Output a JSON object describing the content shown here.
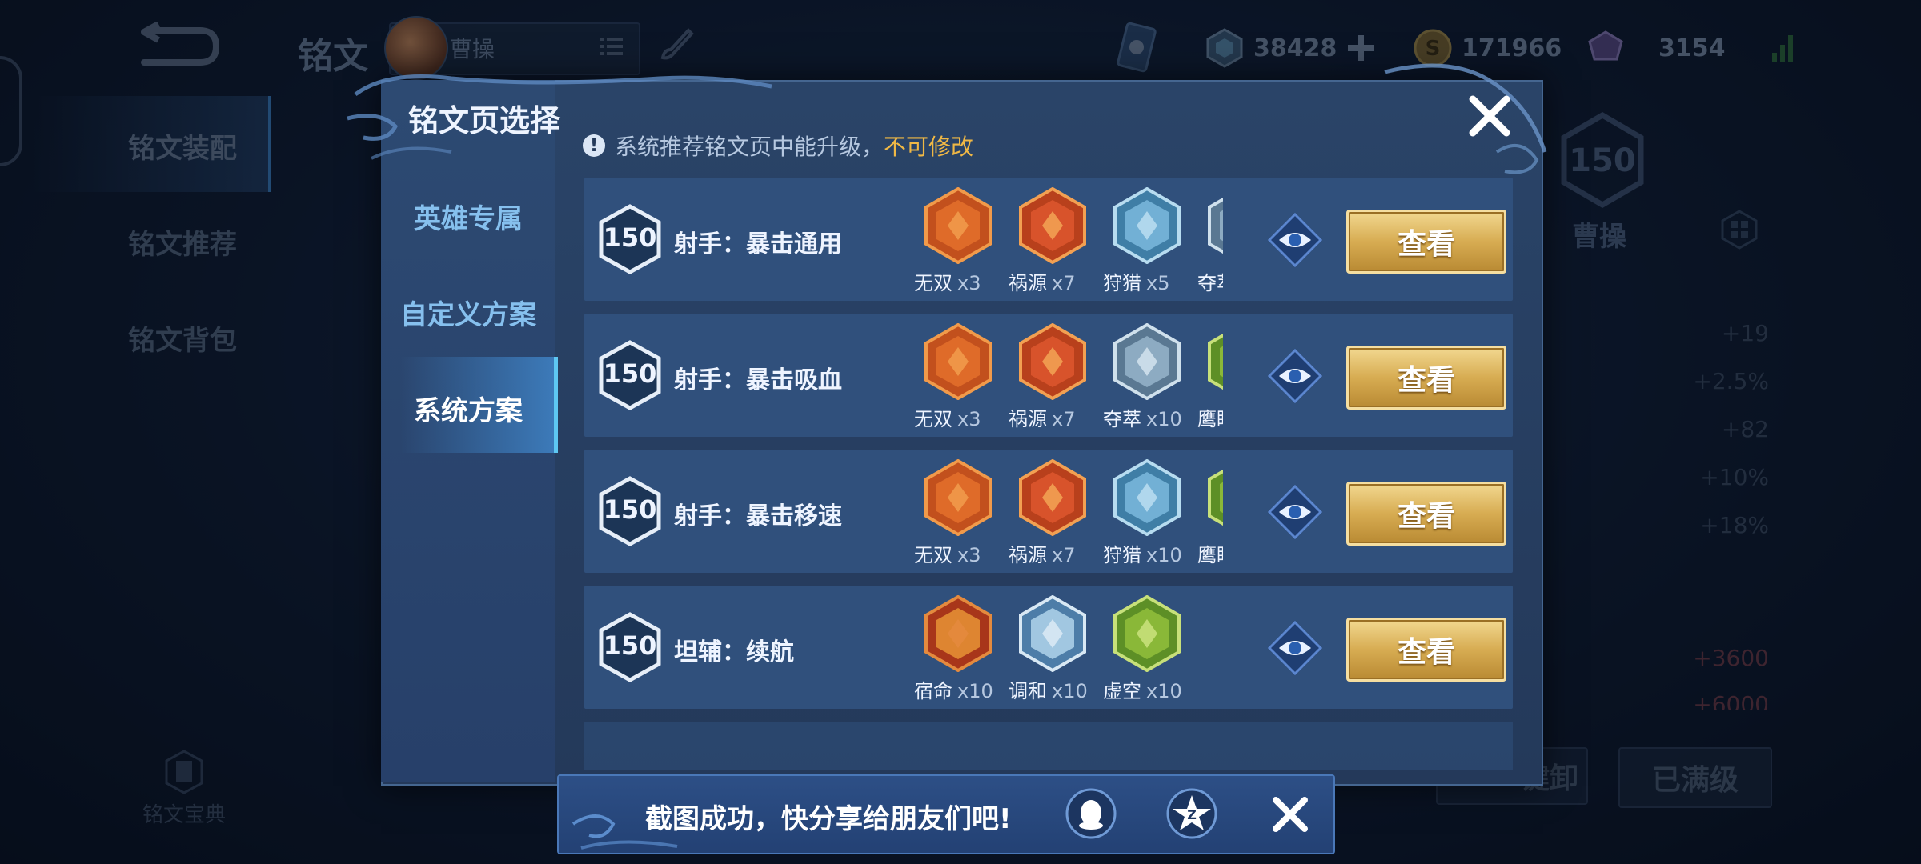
{
  "background": {
    "title": "铭文",
    "hero_name": "曹操",
    "currencies": [
      {
        "icon": "diamond-icon",
        "value": "38428"
      },
      {
        "icon": "gold-coin-icon",
        "value": "171966"
      },
      {
        "icon": "gem-icon",
        "value": "3154"
      }
    ],
    "left_tabs": [
      "铭文装配",
      "铭文推荐",
      "铭文背包"
    ],
    "book_label": "铭文宝典",
    "right_panel": {
      "level": "150",
      "name": "曹操",
      "stats": [
        "+19",
        "+2.5%",
        "+82",
        "+10%",
        "+18%",
        "+3600",
        "+6000"
      ]
    },
    "buttons": {
      "unload_partial": "一键卸",
      "maxed": "已满级"
    }
  },
  "modal": {
    "title": "铭文页选择",
    "tabs": [
      {
        "label": "英雄专属",
        "active": false
      },
      {
        "label": "自定义方案",
        "active": false
      },
      {
        "label": "系统方案",
        "active": true
      }
    ],
    "notice_text": "系统推荐铭文页中能升级，",
    "notice_highlight": "不可修改",
    "view_label": "查看",
    "rows": [
      {
        "level": "150",
        "name": "射手：暴击通用",
        "runes": [
          {
            "name": "无双",
            "count": "x3",
            "kind": "red"
          },
          {
            "name": "祸源",
            "count": "x7",
            "kind": "red2"
          },
          {
            "name": "狩猎",
            "count": "x5",
            "kind": "blue"
          },
          {
            "name": "夺萃",
            "count": "",
            "kind": "blue2"
          }
        ]
      },
      {
        "level": "150",
        "name": "射手：暴击吸血",
        "runes": [
          {
            "name": "无双",
            "count": "x3",
            "kind": "red"
          },
          {
            "name": "祸源",
            "count": "x7",
            "kind": "red2"
          },
          {
            "name": "夺萃",
            "count": "x10",
            "kind": "blue2"
          },
          {
            "name": "鹰眼",
            "count": "",
            "kind": "green"
          }
        ]
      },
      {
        "level": "150",
        "name": "射手：暴击移速",
        "runes": [
          {
            "name": "无双",
            "count": "x3",
            "kind": "red"
          },
          {
            "name": "祸源",
            "count": "x7",
            "kind": "red2"
          },
          {
            "name": "狩猎",
            "count": "x10",
            "kind": "blue"
          },
          {
            "name": "鹰眼",
            "count": "",
            "kind": "green"
          }
        ]
      },
      {
        "level": "150",
        "name": "坦辅：续航",
        "runes": [
          {
            "name": "宿命",
            "count": "x10",
            "kind": "red3"
          },
          {
            "name": "调和",
            "count": "x10",
            "kind": "blue3"
          },
          {
            "name": "虚空",
            "count": "x10",
            "kind": "green"
          }
        ]
      }
    ]
  },
  "toast": {
    "text": "截图成功，快分享给朋友们吧!"
  },
  "colors": {
    "accent_gold": "#f0b845",
    "tab_active": "#5ec7f2",
    "row_bg": "#30507c",
    "modal_bg": "#24395a"
  }
}
